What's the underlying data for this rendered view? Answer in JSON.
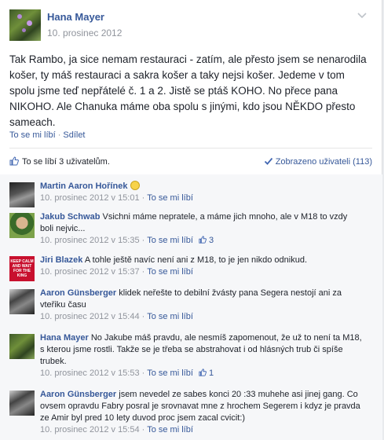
{
  "post": {
    "author": "Hana Mayer",
    "date": "10. prosinec 2012",
    "text": "Tak Rambo, ja sice nemam restauraci - zatím, ale přesto jsem se nenarodila košer, ty máš restauraci a sakra košer a taky nejsi košer. Jedeme v tom spolu jsme teď nepřátelé č. 1 a 2. Jistě se ptáš KOHO. No přece pana NIKOHO. Ale Chanuka máme oba spolu s jinými, kdo jsou NĚKDO přesto sameach.",
    "like_action": "To se mi líbí",
    "share_action": "Sdílet",
    "action_separator": "·",
    "likes_summary": "To se líbí 3 uživatelům.",
    "seen_by": "Zobrazeno uživateli (113)"
  },
  "comments": [
    {
      "name": "Martin Aaron Hořínek",
      "text": "",
      "time": "10. prosinec 2012 v 15:01",
      "like": "To se mi líbí",
      "likes": "",
      "emoji": "smile"
    },
    {
      "name": "Jakub Schwab",
      "text": "Vsichni máme nepratele, a máme jich mnoho, ale v M18 to vzdy boli nejvic...",
      "time": "10. prosinec 2012 v 15:35",
      "like": "To se mi líbí",
      "likes": "3"
    },
    {
      "name": "Jiri Blazek",
      "text": "A tohle ještě navíc není ani z M18, to je jen nikdo odnikud.",
      "time": "10. prosinec 2012 v 15:37",
      "like": "To se mi líbí",
      "likes": "",
      "avatar_text": "KEEP CALM AND WAIT FOR THE KING"
    },
    {
      "name": "Aaron Günsberger",
      "text": "klidek neřešte to debilní žvásty pana Segera nestojí ani za vteřiku času",
      "time": "10. prosinec 2012 v 15:44",
      "like": "To se mi líbí",
      "likes": ""
    },
    {
      "name": "Hana Mayer",
      "text": "No Jakube máš pravdu, ale nesmíš zapomenout, že už to není ta M18, s kterou jsme rostli. Takže se je třeba se abstrahovat i od hlásných trub či spíše trubek.",
      "time": "10. prosinec 2012 v 15:53",
      "like": "To se mi líbí",
      "likes": "1"
    },
    {
      "name": "Aaron Günsberger",
      "text": "jsem nevedel ze sabes konci 20 :33 muhehe asi jinej gang. Co ovsem opravdu Fabry posral je srovnavat mne z hrochem Segerem i kdyz je pravda ze Amir byl pred 10 lety duvod proc jsem zacal cvicit:)",
      "time": "10. prosinec 2012 v 15:54",
      "like": "To se mi líbí",
      "likes": ""
    }
  ],
  "meta_separator": "·",
  "colors": {
    "link": "#365899",
    "meta": "#90949c",
    "background": "#ffffff",
    "comments_bg": "#f6f7f9"
  }
}
